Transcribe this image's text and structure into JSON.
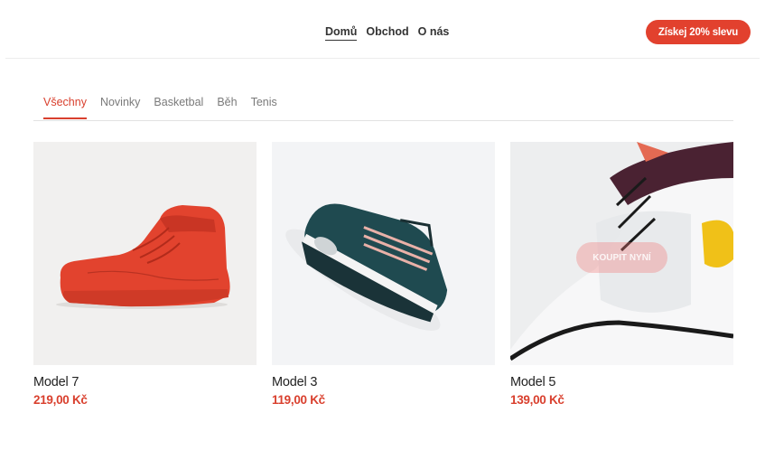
{
  "header": {
    "nav": [
      {
        "label": "Domů",
        "active": true
      },
      {
        "label": "Obchod",
        "active": false
      },
      {
        "label": "O nás",
        "active": false
      }
    ],
    "promo_label": "Získej 20% slevu",
    "accent_color": "#e2412e"
  },
  "tabs": [
    {
      "label": "Všechny",
      "active": true
    },
    {
      "label": "Novinky",
      "active": false
    },
    {
      "label": "Basketbal",
      "active": false
    },
    {
      "label": "Běh",
      "active": false
    },
    {
      "label": "Tenis",
      "active": false
    }
  ],
  "products": [
    {
      "name": "Model 7",
      "price": "219,00 Kč",
      "image": "red-high-top-sneaker"
    },
    {
      "name": "Model 3",
      "price": "119,00 Kč",
      "image": "dark-teal-running-sneaker"
    },
    {
      "name": "Model 5",
      "price": "139,00 Kč",
      "image": "white-sneaker-closeup",
      "overlay_label": "KOUPIT NYNÍ"
    }
  ]
}
